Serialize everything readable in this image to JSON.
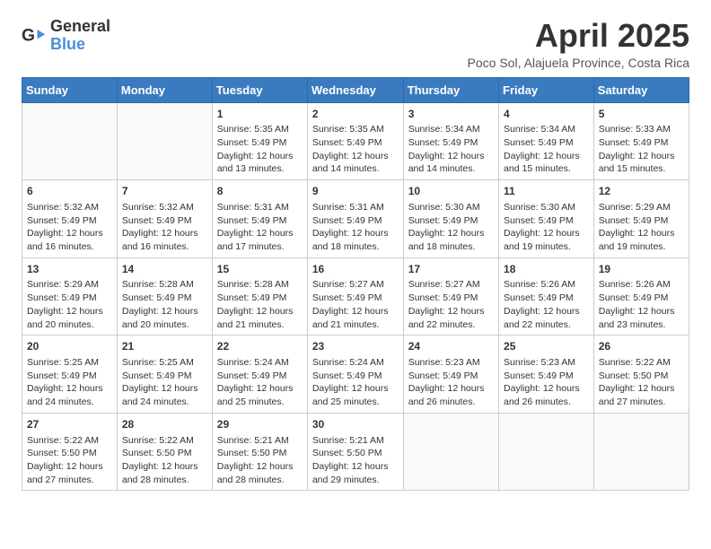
{
  "logo": {
    "line1": "General",
    "line2": "Blue"
  },
  "title": "April 2025",
  "subtitle": "Poco Sol, Alajuela Province, Costa Rica",
  "days_of_week": [
    "Sunday",
    "Monday",
    "Tuesday",
    "Wednesday",
    "Thursday",
    "Friday",
    "Saturday"
  ],
  "weeks": [
    [
      {
        "day": "",
        "info": ""
      },
      {
        "day": "",
        "info": ""
      },
      {
        "day": "1",
        "info": "Sunrise: 5:35 AM\nSunset: 5:49 PM\nDaylight: 12 hours and 13 minutes."
      },
      {
        "day": "2",
        "info": "Sunrise: 5:35 AM\nSunset: 5:49 PM\nDaylight: 12 hours and 14 minutes."
      },
      {
        "day": "3",
        "info": "Sunrise: 5:34 AM\nSunset: 5:49 PM\nDaylight: 12 hours and 14 minutes."
      },
      {
        "day": "4",
        "info": "Sunrise: 5:34 AM\nSunset: 5:49 PM\nDaylight: 12 hours and 15 minutes."
      },
      {
        "day": "5",
        "info": "Sunrise: 5:33 AM\nSunset: 5:49 PM\nDaylight: 12 hours and 15 minutes."
      }
    ],
    [
      {
        "day": "6",
        "info": "Sunrise: 5:32 AM\nSunset: 5:49 PM\nDaylight: 12 hours and 16 minutes."
      },
      {
        "day": "7",
        "info": "Sunrise: 5:32 AM\nSunset: 5:49 PM\nDaylight: 12 hours and 16 minutes."
      },
      {
        "day": "8",
        "info": "Sunrise: 5:31 AM\nSunset: 5:49 PM\nDaylight: 12 hours and 17 minutes."
      },
      {
        "day": "9",
        "info": "Sunrise: 5:31 AM\nSunset: 5:49 PM\nDaylight: 12 hours and 18 minutes."
      },
      {
        "day": "10",
        "info": "Sunrise: 5:30 AM\nSunset: 5:49 PM\nDaylight: 12 hours and 18 minutes."
      },
      {
        "day": "11",
        "info": "Sunrise: 5:30 AM\nSunset: 5:49 PM\nDaylight: 12 hours and 19 minutes."
      },
      {
        "day": "12",
        "info": "Sunrise: 5:29 AM\nSunset: 5:49 PM\nDaylight: 12 hours and 19 minutes."
      }
    ],
    [
      {
        "day": "13",
        "info": "Sunrise: 5:29 AM\nSunset: 5:49 PM\nDaylight: 12 hours and 20 minutes."
      },
      {
        "day": "14",
        "info": "Sunrise: 5:28 AM\nSunset: 5:49 PM\nDaylight: 12 hours and 20 minutes."
      },
      {
        "day": "15",
        "info": "Sunrise: 5:28 AM\nSunset: 5:49 PM\nDaylight: 12 hours and 21 minutes."
      },
      {
        "day": "16",
        "info": "Sunrise: 5:27 AM\nSunset: 5:49 PM\nDaylight: 12 hours and 21 minutes."
      },
      {
        "day": "17",
        "info": "Sunrise: 5:27 AM\nSunset: 5:49 PM\nDaylight: 12 hours and 22 minutes."
      },
      {
        "day": "18",
        "info": "Sunrise: 5:26 AM\nSunset: 5:49 PM\nDaylight: 12 hours and 22 minutes."
      },
      {
        "day": "19",
        "info": "Sunrise: 5:26 AM\nSunset: 5:49 PM\nDaylight: 12 hours and 23 minutes."
      }
    ],
    [
      {
        "day": "20",
        "info": "Sunrise: 5:25 AM\nSunset: 5:49 PM\nDaylight: 12 hours and 24 minutes."
      },
      {
        "day": "21",
        "info": "Sunrise: 5:25 AM\nSunset: 5:49 PM\nDaylight: 12 hours and 24 minutes."
      },
      {
        "day": "22",
        "info": "Sunrise: 5:24 AM\nSunset: 5:49 PM\nDaylight: 12 hours and 25 minutes."
      },
      {
        "day": "23",
        "info": "Sunrise: 5:24 AM\nSunset: 5:49 PM\nDaylight: 12 hours and 25 minutes."
      },
      {
        "day": "24",
        "info": "Sunrise: 5:23 AM\nSunset: 5:49 PM\nDaylight: 12 hours and 26 minutes."
      },
      {
        "day": "25",
        "info": "Sunrise: 5:23 AM\nSunset: 5:49 PM\nDaylight: 12 hours and 26 minutes."
      },
      {
        "day": "26",
        "info": "Sunrise: 5:22 AM\nSunset: 5:50 PM\nDaylight: 12 hours and 27 minutes."
      }
    ],
    [
      {
        "day": "27",
        "info": "Sunrise: 5:22 AM\nSunset: 5:50 PM\nDaylight: 12 hours and 27 minutes."
      },
      {
        "day": "28",
        "info": "Sunrise: 5:22 AM\nSunset: 5:50 PM\nDaylight: 12 hours and 28 minutes."
      },
      {
        "day": "29",
        "info": "Sunrise: 5:21 AM\nSunset: 5:50 PM\nDaylight: 12 hours and 28 minutes."
      },
      {
        "day": "30",
        "info": "Sunrise: 5:21 AM\nSunset: 5:50 PM\nDaylight: 12 hours and 29 minutes."
      },
      {
        "day": "",
        "info": ""
      },
      {
        "day": "",
        "info": ""
      },
      {
        "day": "",
        "info": ""
      }
    ]
  ]
}
